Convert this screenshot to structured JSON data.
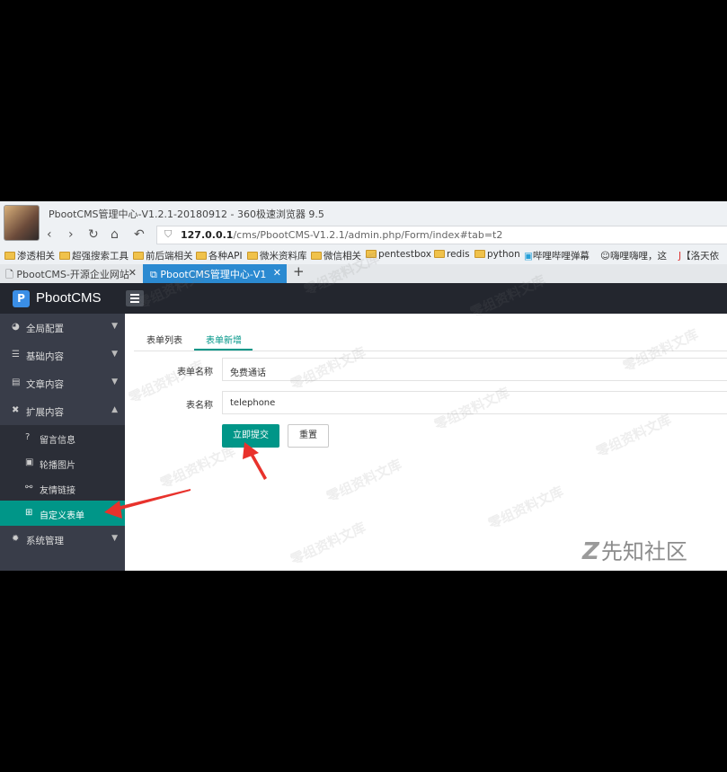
{
  "browser": {
    "window_title": "PbootCMS管理中心-V1.2.1-20180912 - 360极速浏览器 9.5",
    "url_host": "127.0.0.1",
    "url_path": "/cms/PbootCMS-V1.2.1/admin.php/Form/index#tab=t2",
    "bookmarks": [
      "渗透相关",
      "超强搜索工具",
      "前后端相关",
      "各种API",
      "微米资料库",
      "微信相关",
      "pentestbox",
      "redis",
      "python",
      "哔哩哔哩弹幕",
      "嗨哩嗨哩，这",
      "【洛天依"
    ],
    "tabs": [
      {
        "label": "PbootCMS-开源企业网站",
        "active": false
      },
      {
        "label": "PbootCMS管理中心-V1",
        "active": true
      }
    ],
    "new_tab": "+"
  },
  "app": {
    "logo_mark": "P",
    "logo_text": "PbootCMS"
  },
  "sidebar": {
    "items": [
      {
        "label": "全局配置",
        "icon": "gauge-icon",
        "glyph": "◕",
        "caret": "▼"
      },
      {
        "label": "基础内容",
        "icon": "sliders-icon",
        "glyph": "☰",
        "caret": "▼"
      },
      {
        "label": "文章内容",
        "icon": "file-icon",
        "glyph": "▤",
        "caret": "▼"
      },
      {
        "label": "扩展内容",
        "icon": "expand-icon",
        "glyph": "✖",
        "caret": "▲"
      },
      {
        "label": "系统管理",
        "icon": "cog-icon",
        "glyph": "✹",
        "caret": "▼"
      }
    ],
    "sub_items": [
      {
        "label": "留言信息",
        "icon": "question-icon",
        "glyph": "?"
      },
      {
        "label": "轮播图片",
        "icon": "image-icon",
        "glyph": "▣"
      },
      {
        "label": "友情链接",
        "icon": "link-icon",
        "glyph": "⚯"
      },
      {
        "label": "自定义表单",
        "icon": "plus-square-icon",
        "glyph": "⊞"
      }
    ]
  },
  "main": {
    "tabs": [
      "表单列表",
      "表单新增"
    ],
    "form": {
      "name_label": "表单名称",
      "name_value": "免费通话",
      "table_label": "表名称",
      "table_value": "telephone"
    },
    "submit_label": "立即提交",
    "reset_label": "重置"
  },
  "overlays": {
    "watermark": "零组资料文库",
    "corner_logo_text": "先知社区",
    "corner_logo_mark": "Z"
  },
  "colors": {
    "accent": "#009688",
    "sidebar_bg": "#393d49",
    "header_bg": "#23262e",
    "tab_active": "#2b8ad1",
    "annotation_arrow": "#e8322c"
  }
}
